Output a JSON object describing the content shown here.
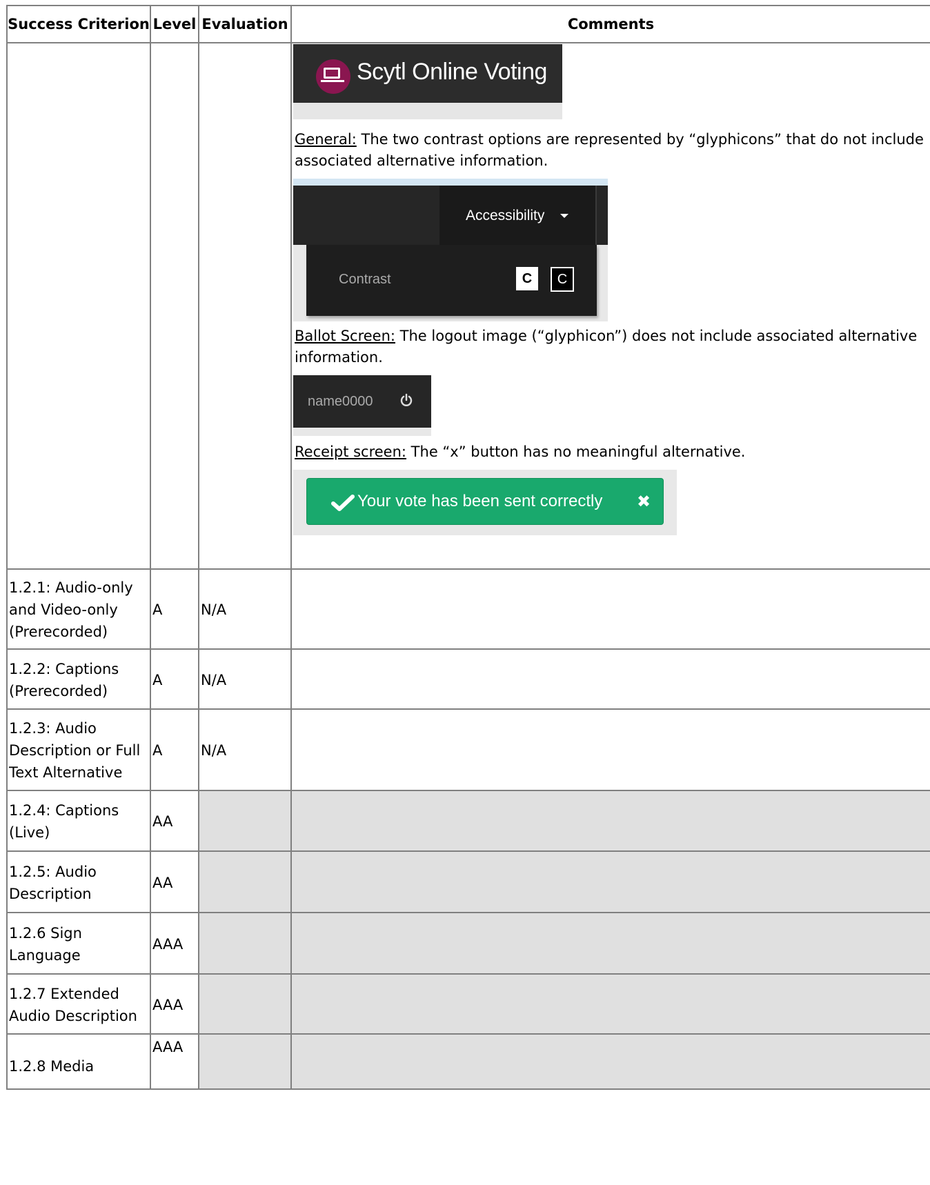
{
  "headers": {
    "criterion": "Success Criterion",
    "level": "Level",
    "evaluation": "Evaluation",
    "comments": "Comments"
  },
  "continuation": {
    "logo_text": "Scytl Online Voting",
    "general_label": "General:",
    "general_text": " The two contrast options are represented by “glyphicons” that do not include associated alternative information.",
    "accessibility_menu": "Accessibility",
    "contrast_label": "Contrast",
    "contrast_btn_1": "C",
    "contrast_btn_2": "C",
    "ballot_label": "Ballot Screen:",
    "ballot_text": " The logout image (“glyphicon”) does not include associated alternative information.",
    "logout_user": "name0000",
    "receipt_label": "Receipt screen:",
    "receipt_text": " The “x” button has no meaningful alternative.",
    "receipt_message": "Your vote has been sent correctly",
    "receipt_close": "✖"
  },
  "rows": [
    {
      "criterion": "1.2.1: Audio-only and Video-only (Prerecorded)",
      "level": "A",
      "evaluation": "N/A",
      "comments": ""
    },
    {
      "criterion": "1.2.2: Captions (Prerecorded)",
      "level": "A",
      "evaluation": "N/A",
      "comments": ""
    },
    {
      "criterion": "1.2.3: Audio Description or Full Text Alternative",
      "level": "A",
      "evaluation": "N/A",
      "comments": ""
    },
    {
      "criterion": "1.2.4: Captions (Live)",
      "level": "AA",
      "evaluation": "",
      "comments": ""
    },
    {
      "criterion": "1.2.5: Audio Description",
      "level": "AA",
      "evaluation": "",
      "comments": ""
    },
    {
      "criterion": "1.2.6 Sign Language",
      "level": "AAA",
      "evaluation": "",
      "comments": ""
    },
    {
      "criterion": "1.2.7 Extended Audio Description",
      "level": "AAA",
      "evaluation": "",
      "comments": ""
    },
    {
      "criterion": "1.2.8 Media",
      "level": "AAA",
      "evaluation": "",
      "comments": ""
    }
  ],
  "colors": {
    "header_border": "#808080",
    "grey_row": "#e0e0e0",
    "logo_circle": "#8a1650",
    "receipt_green": "#19a96d"
  }
}
